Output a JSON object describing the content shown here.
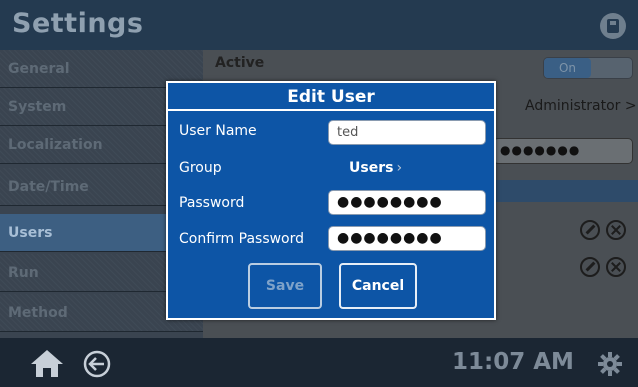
{
  "header": {
    "title": "Settings",
    "save_icon": "save-disk-icon"
  },
  "sidebar": {
    "items": [
      {
        "label": "General"
      },
      {
        "label": "System"
      },
      {
        "label": "Localization"
      },
      {
        "label": "Date/Time"
      },
      {
        "label": "Users",
        "active": true
      },
      {
        "label": "Run"
      },
      {
        "label": "Method"
      }
    ]
  },
  "content": {
    "active_label": "Active",
    "toggle_on": "On",
    "role_value": "Administrator",
    "role_chevron": ">",
    "password_dots": "●●●●●●●"
  },
  "dialog": {
    "title": "Edit User",
    "fields": {
      "username_label": "User Name",
      "username_value": "ted",
      "group_label": "Group",
      "group_value": "Users",
      "group_chevron": "›",
      "password_label": "Password",
      "password_value": "●●●●●●●●",
      "confirm_label": "Confirm Password",
      "confirm_value": "●●●●●●●●"
    },
    "buttons": {
      "save": "Save",
      "cancel": "Cancel"
    }
  },
  "footer": {
    "time": "11:07 AM"
  },
  "colors": {
    "dialog_bg": "#0d55a6",
    "header_bg": "#243a50",
    "active_item": "#3d5f82"
  }
}
